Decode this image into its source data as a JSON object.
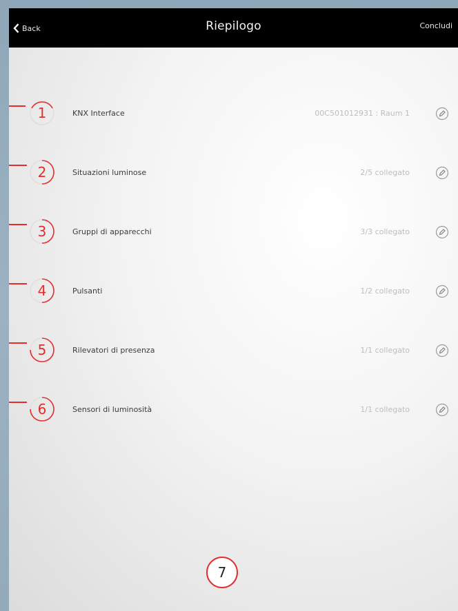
{
  "navbar": {
    "back_label": "Back",
    "title": "Riepilogo",
    "action_label": "Concludi"
  },
  "rows": [
    {
      "step": "1",
      "label": "KNX Interface",
      "value": "00C501012931 : Raum 1"
    },
    {
      "step": "2",
      "label": "Situazioni luminose",
      "value": "2/5 collegato"
    },
    {
      "step": "3",
      "label": "Gruppi di apparecchi",
      "value": "3/3 collegato"
    },
    {
      "step": "4",
      "label": "Pulsanti",
      "value": "1/2 collegato"
    },
    {
      "step": "5",
      "label": "Rilevatori di presenza",
      "value": "1/1 collegato"
    },
    {
      "step": "6",
      "label": "Sensori di luminosità",
      "value": "1/1 collegato"
    }
  ],
  "bottom_step": "7",
  "colors": {
    "accent": "#e32d2d",
    "navbar": "#000000",
    "frame": "#95adbe"
  },
  "icons": {
    "back": "chevron-left-icon",
    "edit": "pencil-icon"
  }
}
